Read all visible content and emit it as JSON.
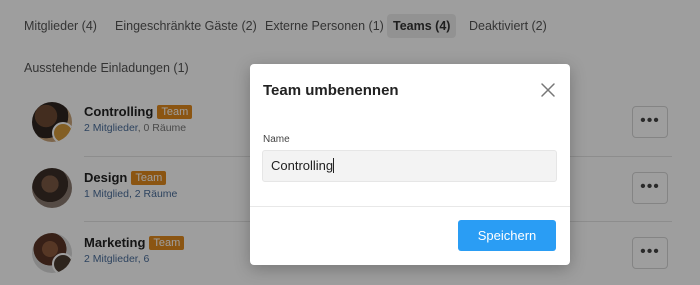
{
  "tabs": [
    {
      "label": "Mitglieder (4)"
    },
    {
      "label": "Eingeschränkte Gäste (2)"
    },
    {
      "label": "Externe Personen (1)"
    },
    {
      "label": "Teams (4)"
    },
    {
      "label": "Deaktiviert (2)"
    }
  ],
  "pending_tab": {
    "label": "Ausstehende Einladungen (1)"
  },
  "teams": [
    {
      "name": "Controlling",
      "badge": "Team",
      "members": "2 Mitglieder",
      "rooms": ", 0 Räume"
    },
    {
      "name": "Design",
      "badge": "Team",
      "members": "1 Mitglied",
      "rooms": ", 2 Räume"
    },
    {
      "name": "Marketing",
      "badge": "Team",
      "members": "2 Mitglieder",
      "rooms": ", 6"
    }
  ],
  "more_glyph": "•••",
  "modal": {
    "title": "Team umbenennen",
    "field_label": "Name",
    "field_value": "Controlling",
    "save_label": "Speichern"
  },
  "colors": {
    "accent": "#2a9df4",
    "badge": "#e08a1e",
    "link": "#4a6d9a"
  }
}
